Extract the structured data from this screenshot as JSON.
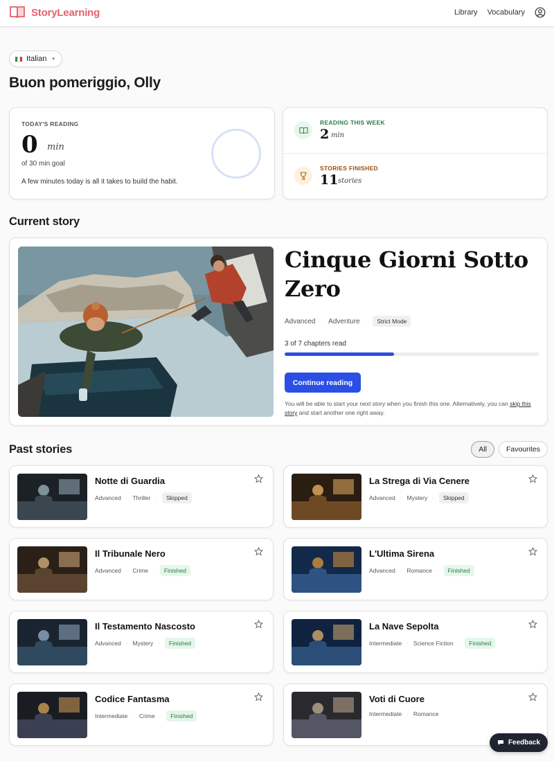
{
  "header": {
    "logo_text": "StoryLearning",
    "nav": {
      "library": "Library",
      "vocabulary": "Vocabulary"
    }
  },
  "language": {
    "selected": "Italian",
    "flag_colors": [
      "#2f8a52",
      "#ffffff",
      "#d23a3a"
    ]
  },
  "greeting": "Buon pomeriggio, Olly",
  "today": {
    "label": "TODAY'S READING",
    "value": "0",
    "unit": "min",
    "goal": "of 30 min goal",
    "message": "A few minutes today is all it takes to build the habit.",
    "progress_fraction": 0
  },
  "weekly": {
    "reading_label": "READING THIS WEEK",
    "reading_value": "2",
    "reading_unit": "min",
    "finished_label": "STORIES FINISHED",
    "finished_value": "11",
    "finished_unit": "stories"
  },
  "current_section_title": "Current story",
  "current_story": {
    "title": "Cinque Giorni Sotto Zero",
    "level": "Advanced",
    "genre": "Adventure",
    "mode_badge": "Strict Mode",
    "progress_text": "3 of 7 chapters read",
    "chapters_read": 3,
    "chapters_total": 7,
    "continue_label": "Continue reading",
    "note_before": "You will be able to start your next story when you finish this one. Alternatively, you can ",
    "note_link": "skip this story",
    "note_after": " and start another one right away."
  },
  "past_section_title": "Past stories",
  "filters": {
    "all": "All",
    "favourites": "Favourites"
  },
  "past_stories": [
    {
      "title": "Notte di Guardia",
      "level": "Advanced",
      "genre": "Thriller",
      "status": "Skipped"
    },
    {
      "title": "La Strega di Via Cenere",
      "level": "Advanced",
      "genre": "Mystery",
      "status": "Skipped"
    },
    {
      "title": "Il Tribunale Nero",
      "level": "Advanced",
      "genre": "Crime",
      "status": "Finished"
    },
    {
      "title": "L'Ultima Sirena",
      "level": "Advanced",
      "genre": "Romance",
      "status": "Finished"
    },
    {
      "title": "Il Testamento Nascosto",
      "level": "Advanced",
      "genre": "Mystery",
      "status": "Finished"
    },
    {
      "title": "La Nave Sepolta",
      "level": "Intermediate",
      "genre": "Science Fiction",
      "status": "Finished"
    },
    {
      "title": "Codice Fantasma",
      "level": "Intermediate",
      "genre": "Crime",
      "status": "Finished"
    },
    {
      "title": "Voti di Cuore",
      "level": "Intermediate",
      "genre": "Romance",
      "status": ""
    }
  ],
  "feedback_label": "Feedback",
  "colors": {
    "brand": "#e5616d",
    "primary": "#2b4fe4",
    "finished_bg": "#e5f6ea",
    "finished_text": "#2c7a47"
  }
}
